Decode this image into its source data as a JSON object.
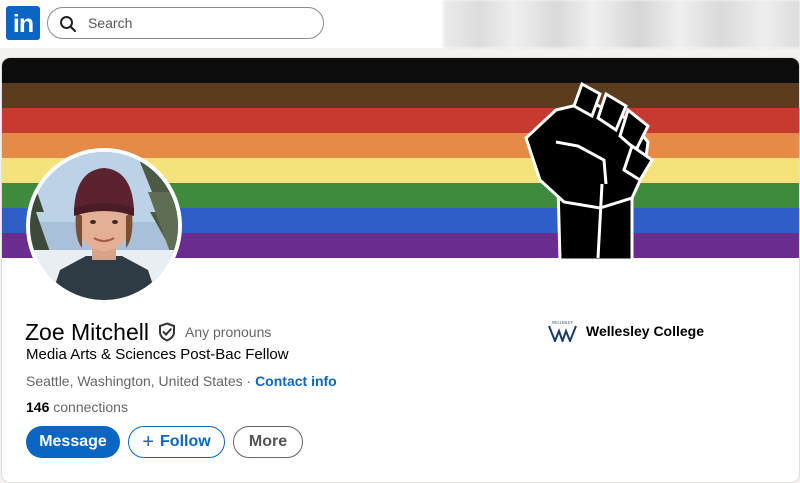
{
  "nav": {
    "logo_text": "in",
    "search_placeholder": "Search",
    "search_icon": "search-icon"
  },
  "banner": {
    "stripe_colors": [
      "#0d0d0d",
      "#5b3c1e",
      "#c63a30",
      "#e58a47",
      "#f4e27b",
      "#3f8a3c",
      "#2f5ec9",
      "#6a2d8f"
    ],
    "fist_icon": "raised-fist-icon"
  },
  "profile": {
    "name": "Zoe Mitchell",
    "verified_icon": "verified-shield-icon",
    "pronouns": "Any pronouns",
    "headline": "Media Arts & Sciences Post-Bac Fellow",
    "location": "Seattle, Washington, United States",
    "separator": " · ",
    "contact_info": "Contact info",
    "connections_count": "146",
    "connections_label": " connections"
  },
  "education": {
    "logo_text": "WELLESLEY",
    "school_name": "Wellesley College"
  },
  "actions": {
    "message": "Message",
    "follow_plus": "+",
    "follow": "Follow",
    "more": "More"
  },
  "colors": {
    "brand": "#0a66c2",
    "page_bg": "#f3f2ef"
  }
}
